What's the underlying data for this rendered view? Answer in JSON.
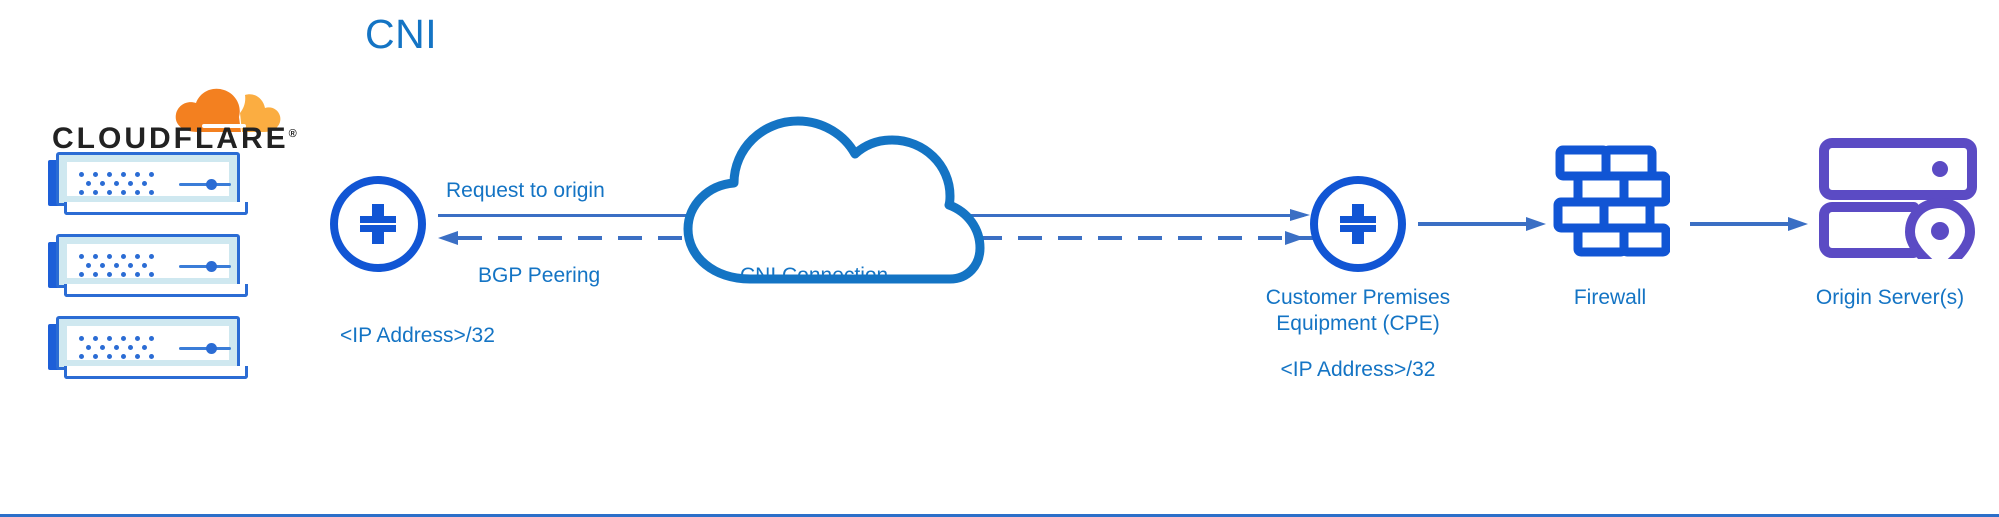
{
  "title": "CNI",
  "colors": {
    "title_blue": "#1474C4",
    "router_blue": "#1155D4",
    "line_blue": "#3B6FC4",
    "server_fill": "#CFE8F0",
    "server_stroke": "#2B6CD4",
    "origin_purple": "#5B4BC4",
    "cloudflare_orange_dark": "#F38020",
    "cloudflare_orange_light": "#FBAD41",
    "wordmark_black": "#222222"
  },
  "cloudflare": {
    "wordmark": "CLOUDFLARE",
    "registered_mark": "®",
    "cloud_icon": "cloudflare-cloud-icon",
    "servers": [
      {
        "name": "cloudflare-server-1"
      },
      {
        "name": "cloudflare-server-2"
      },
      {
        "name": "cloudflare-server-3"
      }
    ]
  },
  "nodes": {
    "cloudflare_router": {
      "icon": "router-icon",
      "label": "<IP Address>/32"
    },
    "cni_cloud": {
      "icon": "cloud-icon",
      "label": "CNI Connection"
    },
    "cpe_router": {
      "icon": "router-icon",
      "label_line1": "Customer Premises",
      "label_line2": "Equipment (CPE)",
      "label_line3": "<IP Address>/32"
    },
    "firewall": {
      "icon": "firewall-brick-icon",
      "label": "Firewall"
    },
    "origin_server": {
      "icon": "origin-server-pin-icon",
      "label": "Origin Server(s)"
    }
  },
  "connections": {
    "request_to_origin": "Request to origin",
    "bgp_peering": "BGP Peering"
  }
}
